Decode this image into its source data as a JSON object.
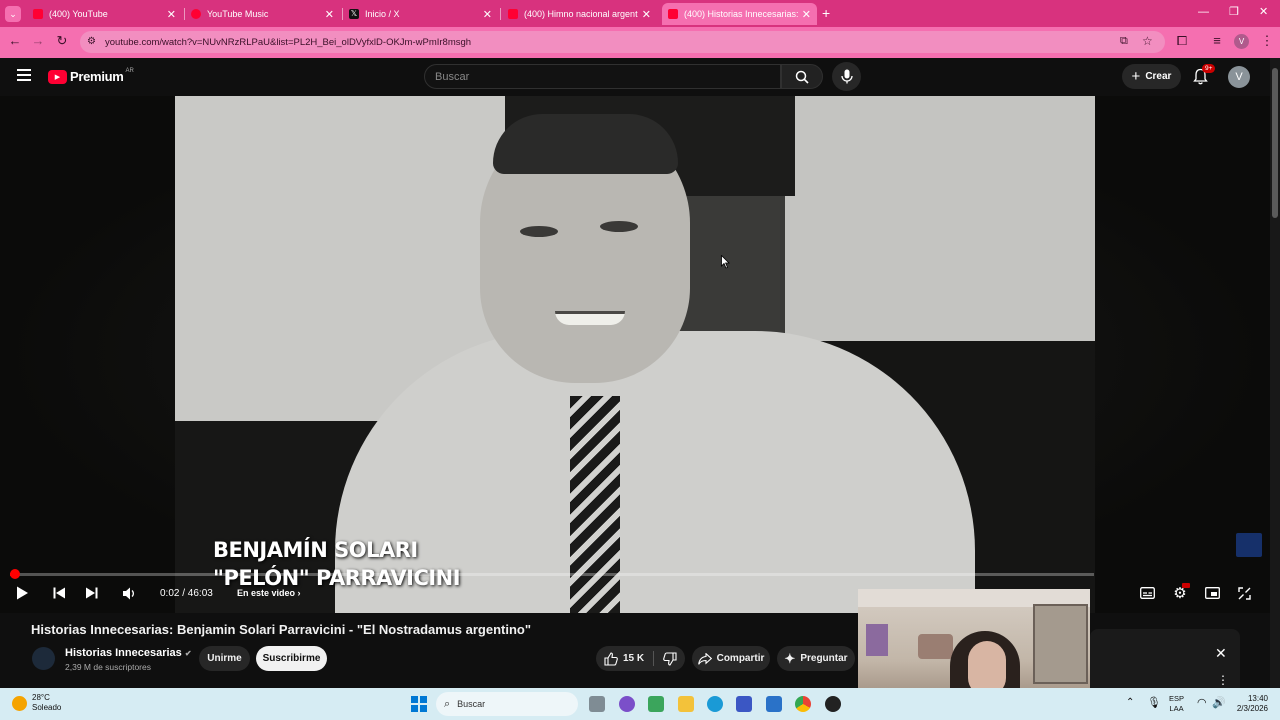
{
  "browser": {
    "tabs": [
      {
        "label": "(400) YouTube",
        "favicon": "youtube-icon",
        "active": false
      },
      {
        "label": "YouTube Music",
        "favicon": "youtube-music-icon",
        "active": false
      },
      {
        "label": "Inicio / X",
        "favicon": "x-icon",
        "active": false
      },
      {
        "label": "(400) Himno nacional argentino",
        "favicon": "youtube-icon",
        "active": false
      },
      {
        "label": "(400) Historias Innecesarias: Benj",
        "favicon": "youtube-icon",
        "active": true
      }
    ],
    "url": "youtube.com/watch?v=NUvNRzRLPaU&list=PL2H_Bei_olDVyfxlD-OKJm-wPmIr8msgh",
    "profile_initial": "V",
    "colors": {
      "tabstrip": "#d8327e",
      "toolbar": "#f56fb0"
    }
  },
  "youtube": {
    "logo_text": "Premium",
    "region": "AR",
    "search_placeholder": "Buscar",
    "create_label": "Crear",
    "notifications_badge": "9+",
    "avatar_initial": "V"
  },
  "player": {
    "caption_line1": "BENJAMÍN SOLARI",
    "caption_line2": "\"PELÓN\" PARRAVICINI",
    "time": "0:02 / 46:03",
    "in_video_label": "En este video",
    "progress": 0.0007
  },
  "video": {
    "title": "Historias Innecesarias: Benjamin Solari Parravicini - \"El Nostradamus argentino\"",
    "channel": "Historias Innecesarias",
    "subscribers": "2,39 M de suscriptores",
    "join_label": "Unirme",
    "subscribe_label": "Suscribirme",
    "likes": "15 K",
    "share_label": "Compartir",
    "ask_label": "Preguntar"
  },
  "taskbar": {
    "weather_temp": "28°C",
    "weather_desc": "Soleado",
    "search_label": "Buscar",
    "lang_line1": "ESP",
    "lang_line2": "LAA",
    "clock_time": "13:40",
    "clock_date": "2/3/2026"
  }
}
